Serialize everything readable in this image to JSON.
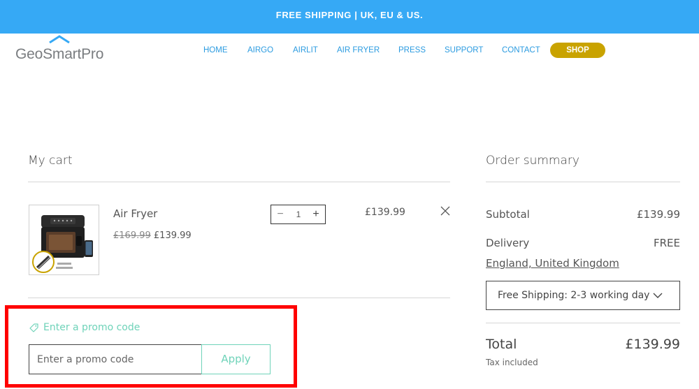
{
  "banner": {
    "text": "FREE SHIPPING | UK, EU & US."
  },
  "header": {
    "logo_text": "GeoSmartPro",
    "nav": [
      "HOME",
      "AIRGO",
      "AIRLIT",
      "AIR FRYER",
      "PRESS",
      "SUPPORT",
      "CONTACT"
    ],
    "shop_label": "SHOP",
    "colors": {
      "nav": "#2b9be0",
      "shop": "#c9a300",
      "banner": "#36a9f5"
    }
  },
  "cart": {
    "title": "My cart",
    "items": [
      {
        "name": "Air Fryer",
        "original_price": "£169.99",
        "sale_price": "£139.99",
        "quantity": "1",
        "line_total": "£139.99",
        "image_icon": "air-fryer-product-image"
      }
    ],
    "promo": {
      "link_label": "Enter a promo code",
      "placeholder": "Enter a promo code",
      "apply_label": "Apply",
      "accent": "#6fd3b9"
    }
  },
  "summary": {
    "title": "Order summary",
    "subtotal_label": "Subtotal",
    "subtotal_value": "£139.99",
    "delivery_label": "Delivery",
    "delivery_value": "FREE",
    "delivery_location": "England, United Kingdom",
    "shipping_option": "Free Shipping: 2-3 working days",
    "total_label": "Total",
    "total_value": "£139.99",
    "tax_note": "Tax included"
  }
}
